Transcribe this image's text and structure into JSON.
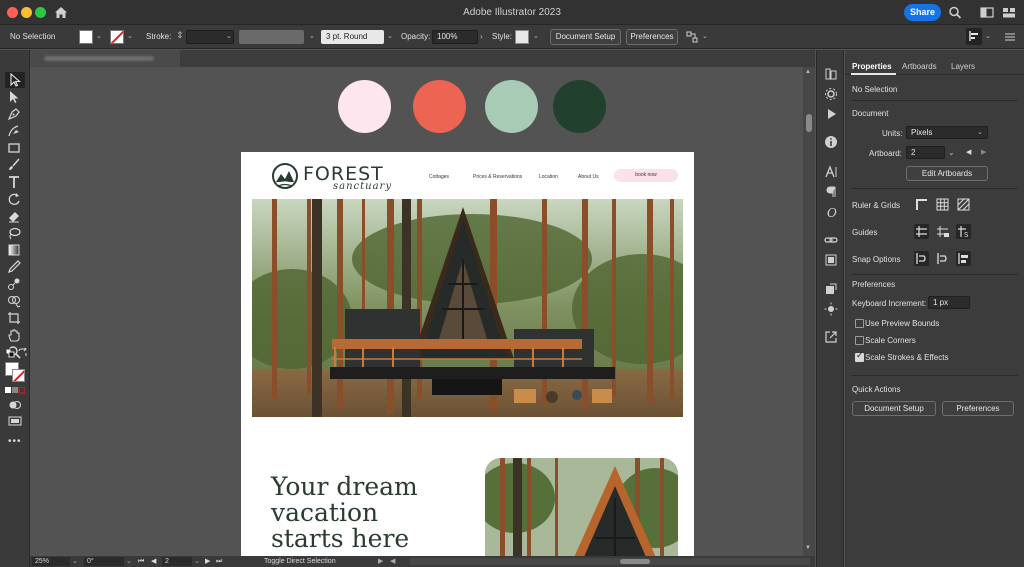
{
  "window": {
    "title": "Adobe Illustrator 2023",
    "share_label": "Share"
  },
  "control_bar": {
    "selection": "No Selection",
    "stroke_label": "Stroke:",
    "stroke_style": "3 pt. Round",
    "opacity_label": "Opacity:",
    "opacity_value": "100%",
    "style_label": "Style:",
    "document_setup": "Document Setup",
    "preferences": "Preferences"
  },
  "artboard": {
    "palette": [
      "#fde6ee",
      "#ee6452",
      "#a8cbb5",
      "#22402e"
    ],
    "logo_title": "FOREST",
    "logo_subtitle": "sanctuary",
    "nav": [
      "Cottages",
      "Prices & Reservations",
      "Location",
      "About Us"
    ],
    "book_label": "book now",
    "headline": [
      "Your dream",
      "vacation",
      "starts here"
    ]
  },
  "status_bar": {
    "zoom": "25%",
    "rotation": "0°",
    "artboard_num": "2",
    "tool_hint": "Toggle Direct Selection"
  },
  "panel": {
    "tabs": [
      "Properties",
      "Artboards",
      "Layers"
    ],
    "selection": "No Selection",
    "document_heading": "Document",
    "units_label": "Units:",
    "units_value": "Pixels",
    "artboard_label": "Artboard:",
    "artboard_value": "2",
    "edit_artboards": "Edit Artboards",
    "ruler_grids": "Ruler & Grids",
    "guides": "Guides",
    "snap_options": "Snap Options",
    "preferences_heading": "Preferences",
    "keyboard_increment_label": "Keyboard Increment:",
    "keyboard_increment_value": "1 px",
    "use_preview_bounds": "Use Preview Bounds",
    "scale_corners": "Scale Corners",
    "scale_strokes": "Scale Strokes & Effects",
    "quick_actions": "Quick Actions",
    "document_setup": "Document Setup",
    "preferences_btn": "Preferences"
  }
}
